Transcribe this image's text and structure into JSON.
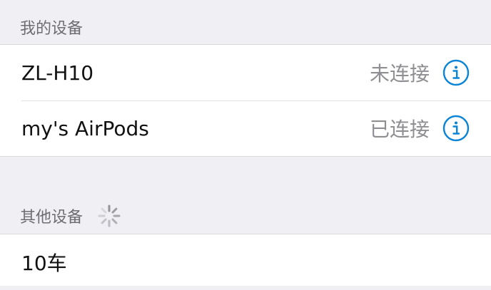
{
  "my_devices": {
    "header": "我的设备",
    "items": [
      {
        "name": "ZL-H10",
        "status": "未连接",
        "icon": "info-icon"
      },
      {
        "name": "my's AirPods",
        "status": "已连接",
        "icon": "info-icon"
      }
    ]
  },
  "other_devices": {
    "header": "其他设备",
    "loading_icon": "spinner-icon",
    "items": [
      {
        "name": "10车"
      }
    ]
  },
  "colors": {
    "accent": "#0a84d6",
    "background": "#efeff4",
    "secondary_text": "#8e8e93"
  }
}
